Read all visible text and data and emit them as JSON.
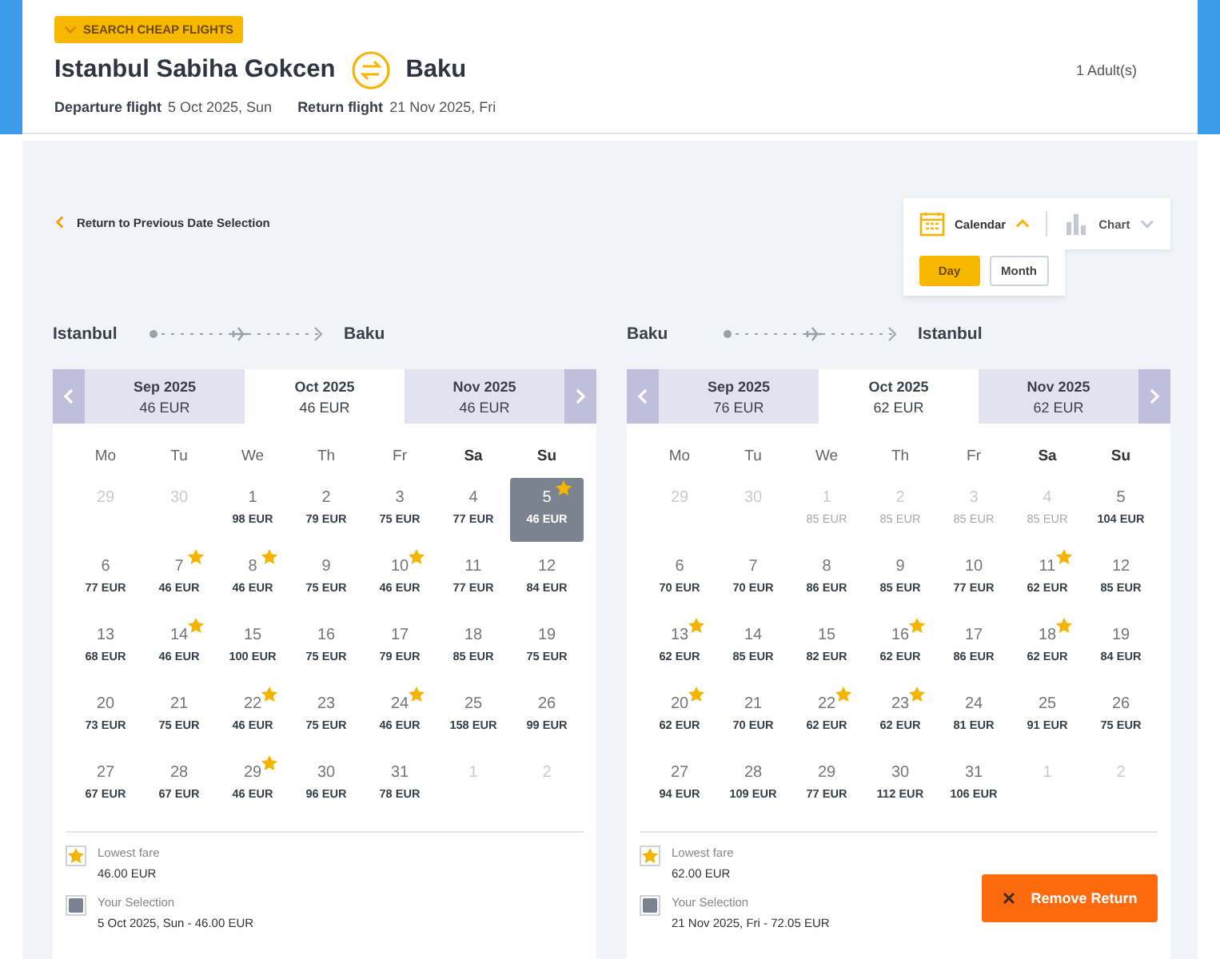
{
  "header": {
    "search_button": "SEARCH CHEAP FLIGHTS",
    "origin": "Istanbul Sabiha Gokcen",
    "destination": "Baku",
    "passengers": "1 Adult(s)",
    "departure_label": "Departure flight",
    "departure_date": "5 Oct 2025, Sun",
    "return_label": "Return flight",
    "return_date": "21 Nov 2025, Fri"
  },
  "back_link": "Return to Previous Date Selection",
  "view_switch": {
    "options": [
      {
        "label": "Calendar",
        "selected": true
      },
      {
        "label": "Chart",
        "selected": false
      }
    ],
    "modes": [
      {
        "label": "Day",
        "selected": true
      },
      {
        "label": "Month",
        "selected": false
      }
    ]
  },
  "legs": [
    {
      "from": "Istanbul",
      "to": "Baku",
      "months": [
        {
          "label": "Sep 2025",
          "price": "46 EUR",
          "selected": false
        },
        {
          "label": "Oct 2025",
          "price": "46 EUR",
          "selected": true
        },
        {
          "label": "Nov 2025",
          "price": "46 EUR",
          "selected": false
        }
      ],
      "weekdays": [
        {
          "label": "Mo",
          "weekend": false
        },
        {
          "label": "Tu",
          "weekend": false
        },
        {
          "label": "We",
          "weekend": false
        },
        {
          "label": "Th",
          "weekend": false
        },
        {
          "label": "Fr",
          "weekend": false
        },
        {
          "label": "Sa",
          "weekend": true
        },
        {
          "label": "Su",
          "weekend": true
        }
      ],
      "days": [
        {
          "day": "29",
          "disabled": true,
          "star": false,
          "selected": false
        },
        {
          "day": "30",
          "disabled": true,
          "star": false,
          "selected": false
        },
        {
          "day": "1",
          "price": "98 EUR",
          "disabled": false,
          "star": false,
          "selected": false
        },
        {
          "day": "2",
          "price": "79 EUR",
          "disabled": false,
          "star": false,
          "selected": false
        },
        {
          "day": "3",
          "price": "75 EUR",
          "disabled": false,
          "star": false,
          "selected": false
        },
        {
          "day": "4",
          "price": "77 EUR",
          "disabled": false,
          "star": false,
          "selected": false
        },
        {
          "day": "5",
          "price": "46 EUR",
          "disabled": false,
          "star": true,
          "selected": true
        },
        {
          "day": "6",
          "price": "77 EUR",
          "disabled": false,
          "star": false,
          "selected": false
        },
        {
          "day": "7",
          "price": "46 EUR",
          "disabled": false,
          "star": true,
          "selected": false
        },
        {
          "day": "8",
          "price": "46 EUR",
          "disabled": false,
          "star": true,
          "selected": false
        },
        {
          "day": "9",
          "price": "75 EUR",
          "disabled": false,
          "star": false,
          "selected": false
        },
        {
          "day": "10",
          "price": "46 EUR",
          "disabled": false,
          "star": true,
          "selected": false
        },
        {
          "day": "11",
          "price": "77 EUR",
          "disabled": false,
          "star": false,
          "selected": false
        },
        {
          "day": "12",
          "price": "84 EUR",
          "disabled": false,
          "star": false,
          "selected": false
        },
        {
          "day": "13",
          "price": "68 EUR",
          "disabled": false,
          "star": false,
          "selected": false
        },
        {
          "day": "14",
          "price": "46 EUR",
          "disabled": false,
          "star": true,
          "selected": false
        },
        {
          "day": "15",
          "price": "100 EUR",
          "disabled": false,
          "star": false,
          "selected": false
        },
        {
          "day": "16",
          "price": "75 EUR",
          "disabled": false,
          "star": false,
          "selected": false
        },
        {
          "day": "17",
          "price": "79 EUR",
          "disabled": false,
          "star": false,
          "selected": false
        },
        {
          "day": "18",
          "price": "85 EUR",
          "disabled": false,
          "star": false,
          "selected": false
        },
        {
          "day": "19",
          "price": "75 EUR",
          "disabled": false,
          "star": false,
          "selected": false
        },
        {
          "day": "20",
          "price": "73 EUR",
          "disabled": false,
          "star": false,
          "selected": false
        },
        {
          "day": "21",
          "price": "75 EUR",
          "disabled": false,
          "star": false,
          "selected": false
        },
        {
          "day": "22",
          "price": "46 EUR",
          "disabled": false,
          "star": true,
          "selected": false
        },
        {
          "day": "23",
          "price": "75 EUR",
          "disabled": false,
          "star": false,
          "selected": false
        },
        {
          "day": "24",
          "price": "46 EUR",
          "disabled": false,
          "star": true,
          "selected": false
        },
        {
          "day": "25",
          "price": "158 EUR",
          "disabled": false,
          "star": false,
          "selected": false
        },
        {
          "day": "26",
          "price": "99 EUR",
          "disabled": false,
          "star": false,
          "selected": false
        },
        {
          "day": "27",
          "price": "67 EUR",
          "disabled": false,
          "star": false,
          "selected": false
        },
        {
          "day": "28",
          "price": "67 EUR",
          "disabled": false,
          "star": false,
          "selected": false
        },
        {
          "day": "29",
          "price": "46 EUR",
          "disabled": false,
          "star": true,
          "selected": false
        },
        {
          "day": "30",
          "price": "96 EUR",
          "disabled": false,
          "star": false,
          "selected": false
        },
        {
          "day": "31",
          "price": "78 EUR",
          "disabled": false,
          "star": false,
          "selected": false
        },
        {
          "day": "1",
          "disabled": true,
          "star": false,
          "selected": false
        },
        {
          "day": "2",
          "disabled": true,
          "star": false,
          "selected": false
        }
      ],
      "legend": [
        {
          "kind": "star",
          "label": "Lowest fare",
          "value": "46.00 EUR"
        },
        {
          "kind": "selection",
          "label": "Your Selection",
          "value": "5 Oct 2025, Sun - 46.00 EUR"
        }
      ]
    },
    {
      "from": "Baku",
      "to": "Istanbul",
      "months": [
        {
          "label": "Sep 2025",
          "price": "76 EUR",
          "selected": false
        },
        {
          "label": "Oct 2025",
          "price": "62 EUR",
          "selected": true
        },
        {
          "label": "Nov 2025",
          "price": "62 EUR",
          "selected": false
        }
      ],
      "weekdays": [
        {
          "label": "Mo",
          "weekend": false
        },
        {
          "label": "Tu",
          "weekend": false
        },
        {
          "label": "We",
          "weekend": false
        },
        {
          "label": "Th",
          "weekend": false
        },
        {
          "label": "Fr",
          "weekend": false
        },
        {
          "label": "Sa",
          "weekend": true
        },
        {
          "label": "Su",
          "weekend": true
        }
      ],
      "days": [
        {
          "day": "29",
          "disabled": true,
          "star": false,
          "selected": false
        },
        {
          "day": "30",
          "disabled": true,
          "star": false,
          "selected": false
        },
        {
          "day": "1",
          "price": "85 EUR",
          "disabled": true,
          "star": false,
          "selected": false
        },
        {
          "day": "2",
          "price": "85 EUR",
          "disabled": true,
          "star": false,
          "selected": false
        },
        {
          "day": "3",
          "price": "85 EUR",
          "disabled": true,
          "star": false,
          "selected": false
        },
        {
          "day": "4",
          "price": "85 EUR",
          "disabled": true,
          "star": false,
          "selected": false
        },
        {
          "day": "5",
          "price": "104 EUR",
          "disabled": false,
          "star": false,
          "selected": false
        },
        {
          "day": "6",
          "price": "70 EUR",
          "disabled": false,
          "star": false,
          "selected": false
        },
        {
          "day": "7",
          "price": "70 EUR",
          "disabled": false,
          "star": false,
          "selected": false
        },
        {
          "day": "8",
          "price": "86 EUR",
          "disabled": false,
          "star": false,
          "selected": false
        },
        {
          "day": "9",
          "price": "85 EUR",
          "disabled": false,
          "star": false,
          "selected": false
        },
        {
          "day": "10",
          "price": "77 EUR",
          "disabled": false,
          "star": false,
          "selected": false
        },
        {
          "day": "11",
          "price": "62 EUR",
          "disabled": false,
          "star": true,
          "selected": false
        },
        {
          "day": "12",
          "price": "85 EUR",
          "disabled": false,
          "star": false,
          "selected": false
        },
        {
          "day": "13",
          "price": "62 EUR",
          "disabled": false,
          "star": true,
          "selected": false
        },
        {
          "day": "14",
          "price": "85 EUR",
          "disabled": false,
          "star": false,
          "selected": false
        },
        {
          "day": "15",
          "price": "82 EUR",
          "disabled": false,
          "star": false,
          "selected": false
        },
        {
          "day": "16",
          "price": "62 EUR",
          "disabled": false,
          "star": true,
          "selected": false
        },
        {
          "day": "17",
          "price": "86 EUR",
          "disabled": false,
          "star": false,
          "selected": false
        },
        {
          "day": "18",
          "price": "62 EUR",
          "disabled": false,
          "star": true,
          "selected": false
        },
        {
          "day": "19",
          "price": "84 EUR",
          "disabled": false,
          "star": false,
          "selected": false
        },
        {
          "day": "20",
          "price": "62 EUR",
          "disabled": false,
          "star": true,
          "selected": false
        },
        {
          "day": "21",
          "price": "70 EUR",
          "disabled": false,
          "star": false,
          "selected": false
        },
        {
          "day": "22",
          "price": "62 EUR",
          "disabled": false,
          "star": true,
          "selected": false
        },
        {
          "day": "23",
          "price": "62 EUR",
          "disabled": false,
          "star": true,
          "selected": false
        },
        {
          "day": "24",
          "price": "81 EUR",
          "disabled": false,
          "star": false,
          "selected": false
        },
        {
          "day": "25",
          "price": "91 EUR",
          "disabled": false,
          "star": false,
          "selected": false
        },
        {
          "day": "26",
          "price": "75 EUR",
          "disabled": false,
          "star": false,
          "selected": false
        },
        {
          "day": "27",
          "price": "94 EUR",
          "disabled": false,
          "star": false,
          "selected": false
        },
        {
          "day": "28",
          "price": "109 EUR",
          "disabled": false,
          "star": false,
          "selected": false
        },
        {
          "day": "29",
          "price": "77 EUR",
          "disabled": false,
          "star": false,
          "selected": false
        },
        {
          "day": "30",
          "price": "112 EUR",
          "disabled": false,
          "star": false,
          "selected": false
        },
        {
          "day": "31",
          "price": "106 EUR",
          "disabled": false,
          "star": false,
          "selected": false
        },
        {
          "day": "1",
          "disabled": true,
          "star": false,
          "selected": false
        },
        {
          "day": "2",
          "disabled": true,
          "star": false,
          "selected": false
        }
      ],
      "legend": [
        {
          "kind": "star",
          "label": "Lowest fare",
          "value": "62.00 EUR"
        },
        {
          "kind": "selection",
          "label": "Your Selection",
          "value": "21 Nov 2025, Fri - 72.05 EUR"
        }
      ],
      "action": "Remove Return"
    }
  ]
}
